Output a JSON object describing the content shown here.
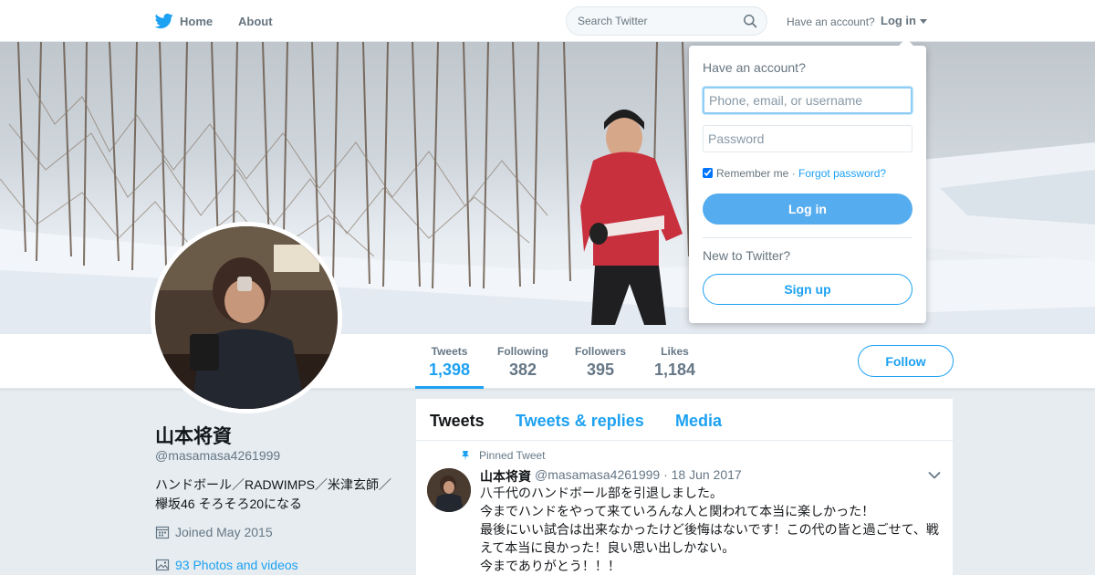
{
  "nav": {
    "home_label": "Home",
    "about_label": "About",
    "search_placeholder": "Search Twitter",
    "have_account": "Have an account?",
    "login_label": "Log in",
    "brand_icon": "twitter-bird-icon",
    "accent": "#1da1f2"
  },
  "login_dropdown": {
    "title": "Have an account?",
    "username_placeholder": "Phone, email, or username",
    "password_placeholder": "Password",
    "remember_label": "Remember me",
    "separator": "·",
    "forgot_label": "Forgot password?",
    "login_button": "Log in",
    "new_label": "New to Twitter?",
    "signup_button": "Sign up",
    "remember_checked": true
  },
  "profile_nav": {
    "stats": [
      {
        "label": "Tweets",
        "value": "1,398"
      },
      {
        "label": "Following",
        "value": "382"
      },
      {
        "label": "Followers",
        "value": "395"
      },
      {
        "label": "Likes",
        "value": "1,184"
      }
    ],
    "active_stat": "Tweets",
    "follow_label": "Follow"
  },
  "profile": {
    "name": "山本将資",
    "handle": "@masamasa4261999",
    "bio_line1": "ハンドボール／RADWIMPS／米津玄師／",
    "bio_line2": "欅坂46 そろそろ20になる",
    "joined": "Joined May 2015",
    "photos": "93 Photos and videos"
  },
  "timeline": {
    "tabs": [
      "Tweets",
      "Tweets & replies",
      "Media"
    ],
    "active_tab": "Tweets",
    "pinned_label": "Pinned Tweet",
    "tweet": {
      "name": "山本将資",
      "handle_date": "@masamasa4261999 · 18 Jun 2017",
      "lines": [
        "八千代のハンドボール部を引退しました。",
        "今までハンドをやって来ていろんな人と関われて本当に楽しかった！",
        "最後にいい試合は出来なかったけど後悔はないです！この代の皆と過ごせて、戦",
        "えて本当に良かった！良い思い出しかない。",
        "今までありがとう！！！"
      ]
    }
  }
}
